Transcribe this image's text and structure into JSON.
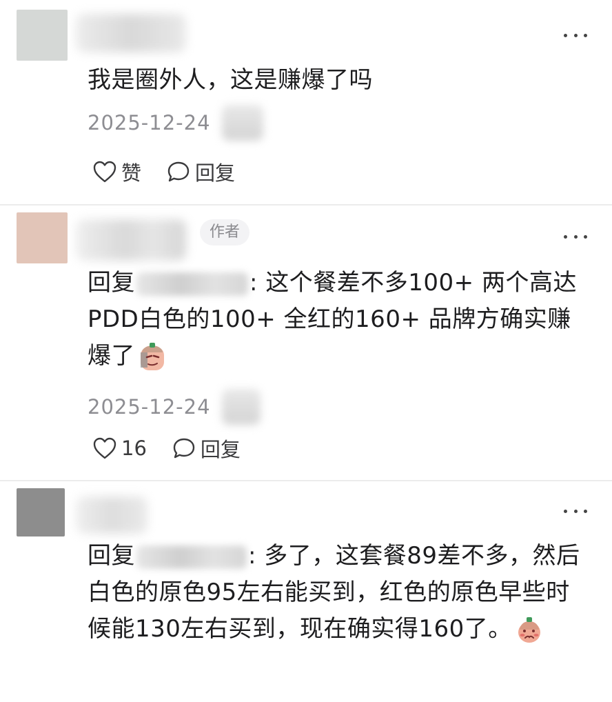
{
  "comments": [
    {
      "text": "我是圈外人，这是赚爆了吗",
      "date": "2025-12-24",
      "like_label": "赞",
      "reply_label": "回复",
      "more_icon": "more-dots-icon",
      "avatar_color": "#d5d8d6"
    },
    {
      "author_tag": "作者",
      "reply_prefix": "回复",
      "text": ": 这个餐差不多100+ 两个高达PDD白色的100+ 全红的160+ 品牌方确实赚爆了",
      "date": "2025-12-24",
      "like_count": "16",
      "reply_label": "回复",
      "emoji": "sly-face-emoji",
      "avatar_color": "#e2c5b8"
    },
    {
      "reply_prefix": "回复",
      "text": ": 多了，这套餐89差不多，然后白色的原色95左右能买到，红色的原色早些时候能130左右买到，现在确实得160了。",
      "emoji": "shy-face-emoji",
      "avatar_color": "#8d8d8d"
    }
  ]
}
